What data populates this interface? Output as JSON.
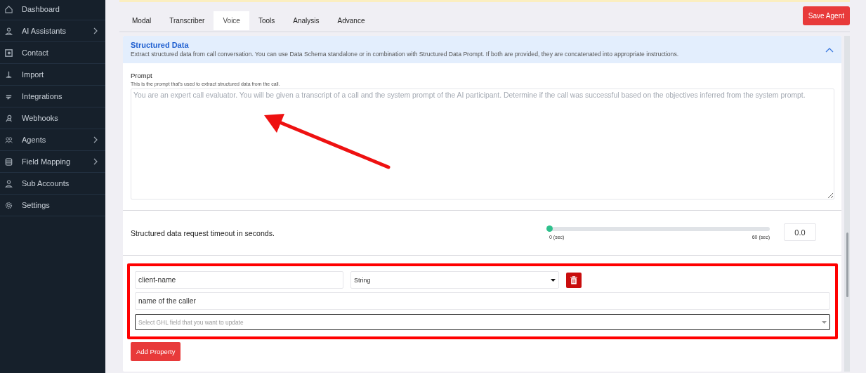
{
  "sidebar": {
    "items": [
      {
        "label": "Dashboard",
        "has_submenu": false
      },
      {
        "label": "AI Assistants",
        "has_submenu": true
      },
      {
        "label": "Contact",
        "has_submenu": false
      },
      {
        "label": "Import",
        "has_submenu": false
      },
      {
        "label": "Integrations",
        "has_submenu": false
      },
      {
        "label": "Webhooks",
        "has_submenu": false
      },
      {
        "label": "Agents",
        "has_submenu": true
      },
      {
        "label": "Field Mapping",
        "has_submenu": true
      },
      {
        "label": "Sub Accounts",
        "has_submenu": false
      },
      {
        "label": "Settings",
        "has_submenu": false
      }
    ]
  },
  "tabs": [
    {
      "label": "Modal",
      "selected": false
    },
    {
      "label": "Transcriber",
      "selected": false
    },
    {
      "label": "Voice",
      "selected": true
    },
    {
      "label": "Tools",
      "selected": false
    },
    {
      "label": "Analysis",
      "selected": false
    },
    {
      "label": "Advance",
      "selected": false
    }
  ],
  "save_button": "Save Agent",
  "section": {
    "title": "Structured Data",
    "description": "Extract structured data from call conversation. You can use Data Schema standalone or in combination with Structured Data Prompt. If both are provided, they are concatenated into appropriate instructions.",
    "expanded": true,
    "prompt": {
      "label": "Prompt",
      "hint": "This is the prompt that's used to extract structured data from the call.",
      "placeholder": "You are an expert call evaluator. You will be given a transcript of a call and the system prompt of the AI participant. Determine if the call was successful based on the objectives inferred from the system prompt."
    },
    "timeout": {
      "label": "Structured data request timeout in seconds.",
      "level": 0,
      "min_label": "0 (sec)",
      "max_label": "60 (sec)",
      "value": "0.0"
    },
    "property": {
      "name": "client-name",
      "type": "String",
      "description": "name of the caller",
      "ghl_placeholder": "Select GHL field that you want to update"
    },
    "add_button": "Add Property"
  }
}
